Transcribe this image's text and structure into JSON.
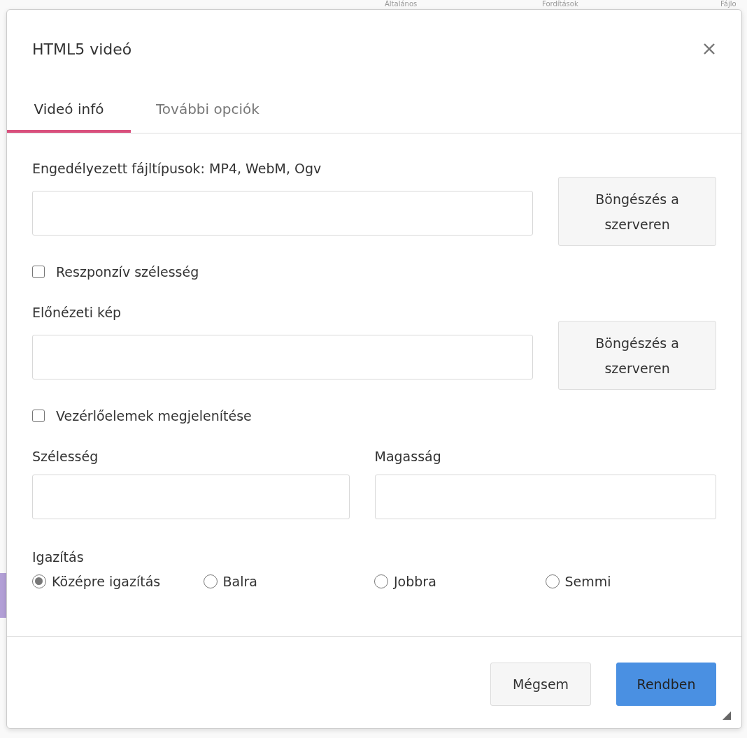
{
  "background_nav": [
    {
      "label": "Általános"
    },
    {
      "label": "Fordítások"
    },
    {
      "label": "Fájlo"
    }
  ],
  "dialog": {
    "title": "HTML5 videó",
    "tabs": [
      {
        "label": "Videó infó",
        "selected": true
      },
      {
        "label": "További opciók",
        "selected": false
      }
    ],
    "source": {
      "label": "Engedélyezett fájltípusok: MP4, WebM, Ogv",
      "button": "Böngészés a szerveren"
    },
    "responsive": {
      "label": "Reszponzív szélesség",
      "checked": false
    },
    "poster": {
      "label": "Előnézeti kép",
      "button": "Böngészés a szerveren"
    },
    "controls": {
      "label": "Vezérlőelemek megjelenítése",
      "checked": false
    },
    "width": {
      "label": "Szélesség"
    },
    "height": {
      "label": "Magasság"
    },
    "alignment": {
      "label": "Igazítás",
      "options": [
        {
          "label": "Középre igazítás",
          "selected": true
        },
        {
          "label": "Balra",
          "selected": false
        },
        {
          "label": "Jobbra",
          "selected": false
        },
        {
          "label": "Semmi",
          "selected": false
        }
      ]
    },
    "buttons": [
      {
        "label": "Mégsem",
        "kind": "secondary"
      },
      {
        "label": "Rendben",
        "kind": "primary"
      }
    ]
  }
}
